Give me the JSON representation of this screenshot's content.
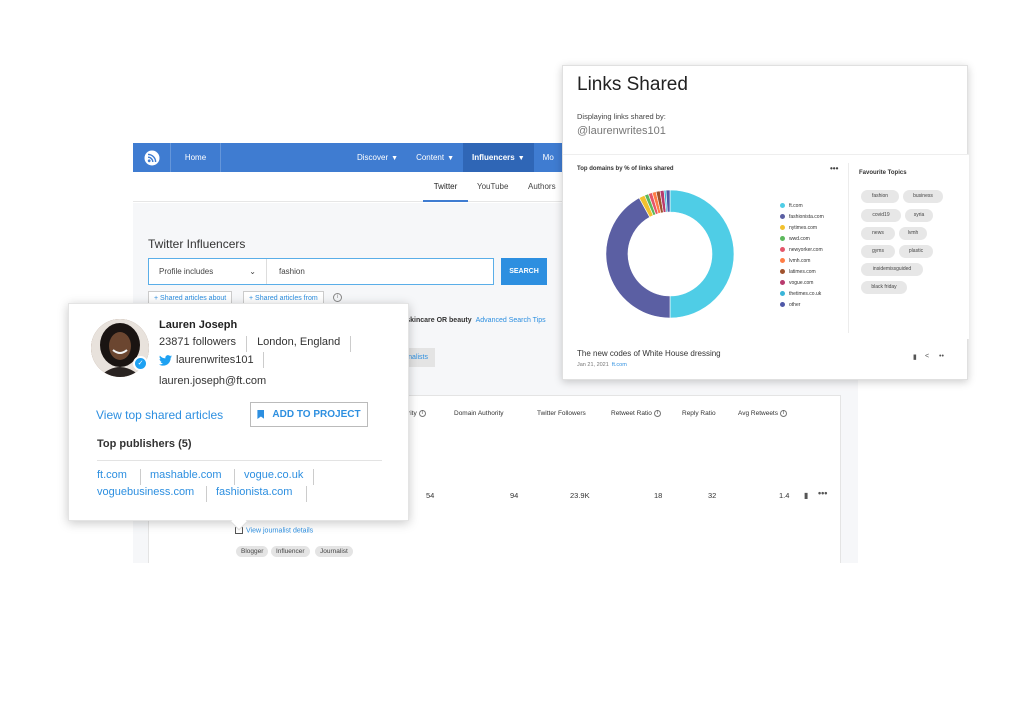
{
  "colors": {
    "nav_blue": "#3f7cd1",
    "link_blue": "#2d8fe0",
    "twitter_blue": "#1da1f2"
  },
  "nav": {
    "logo_icon": "rss-feed-icon",
    "home": "Home",
    "discover": "Discover",
    "content": "Content",
    "influencers": "Influencers",
    "more": "Mo"
  },
  "subnav": {
    "twitter": "Twitter",
    "youtube": "YouTube",
    "authors": "Authors"
  },
  "page": {
    "title": "Twitter Influencers",
    "profile_select": "Profile includes",
    "search_value": "fashion",
    "search_button": "SEARCH",
    "shared_about": "Shared articles about",
    "shared_from": "Shared articles from",
    "query_prefix": "r:",
    "query_terms": "skincare OR beauty",
    "advanced": "Advanced Search Tips",
    "journalist_btn": "nalists"
  },
  "table": {
    "headers": {
      "authority": "thority",
      "domain_authority": "Domain Authority",
      "twitter_followers": "Twitter Followers",
      "retweet_ratio": "Retweet Ratio",
      "reply_ratio": "Reply Ratio",
      "avg_retweets": "Avg Retweets"
    },
    "row": {
      "authority": "54",
      "domain_authority": "94",
      "twitter_followers": "23.9K",
      "retweet_ratio": "18",
      "reply_ratio": "32",
      "avg_retweets": "1.4"
    },
    "view_journalist": "View journalist details",
    "tags": [
      "Blogger",
      "Influencer",
      "Journalist"
    ]
  },
  "profile": {
    "name": "Lauren Joseph",
    "followers": "23871 followers",
    "location": "London, England",
    "handle": "laurenwrites101",
    "email": "lauren.joseph@ft.com",
    "view_top_shared": "View top shared articles",
    "add_to_project": "ADD TO PROJECT",
    "top_publishers": "Top publishers (5)",
    "publishers": [
      "ft.com",
      "mashable.com",
      "vogue.co.uk",
      "voguebusiness.com",
      "fashionista.com"
    ]
  },
  "links_panel": {
    "title": "Links Shared",
    "subtitle": "Displaying links shared by:",
    "handle": "@laurenwrites101",
    "chart_title": "Top domains by % of links shared",
    "more": "•••",
    "favourite_title": "Favourite Topics",
    "topics": [
      "fashion",
      "business",
      "covid19",
      "syria",
      "news",
      "lvmh",
      "gyms",
      "plastic",
      "insidemissguided",
      "black friday"
    ],
    "article_title": "The new codes of White House dressing",
    "article_date": "Jan 21, 2021",
    "article_source": "ft.com"
  },
  "chart_data": {
    "type": "pie",
    "title": "Top domains by % of links shared",
    "categories": [
      "ft.com",
      "fashionista.com",
      "nytimes.com",
      "wwd.com",
      "newyorker.com",
      "lvmh.com",
      "latimes.com",
      "vogue.com",
      "thetimes.co.uk",
      "other"
    ],
    "values": [
      50,
      42,
      1.5,
      1,
      1,
      1,
      1,
      1,
      0.5,
      1
    ],
    "colors": [
      "#4fcde6",
      "#5b5fa3",
      "#f2c12e",
      "#5cb85c",
      "#e4566b",
      "#ff7d45",
      "#a0522d",
      "#b83a6e",
      "#3ab5d9",
      "#4f58a8"
    ],
    "legend": "right"
  }
}
